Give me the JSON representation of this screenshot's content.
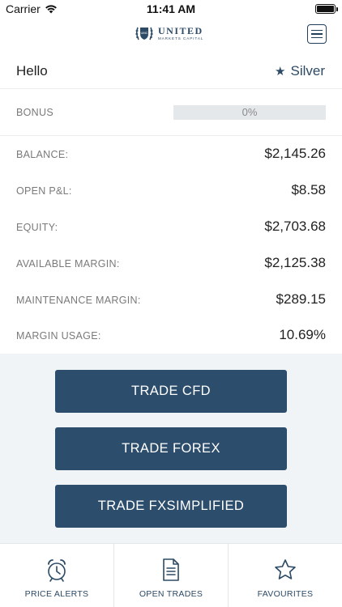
{
  "status_bar": {
    "carrier": "Carrier",
    "time": "11:41 AM"
  },
  "header": {
    "logo": {
      "main": "UNITED",
      "sub": "MARKETS CAPITAL"
    },
    "menu_icon": "hamburger-menu-icon"
  },
  "greeting": {
    "text": "Hello",
    "tier_icon": "star-icon",
    "tier": "Silver"
  },
  "bonus": {
    "label": "BONUS",
    "percent_text": "0%",
    "progress": 0
  },
  "account": [
    {
      "label": "BALANCE:",
      "value": "$2,145.26"
    },
    {
      "label": "OPEN P&L:",
      "value": "$8.58"
    },
    {
      "label": "EQUITY:",
      "value": "$2,703.68"
    },
    {
      "label": "AVAILABLE MARGIN:",
      "value": "$2,125.38"
    },
    {
      "label": "MAINTENANCE MARGIN:",
      "value": "$289.15"
    },
    {
      "label": "MARGIN USAGE:",
      "value": "10.69%"
    }
  ],
  "actions": {
    "trade_cfd": "TRADE CFD",
    "trade_forex": "TRADE FOREX",
    "trade_fxsimplified": "TRADE FXSIMPLIFIED"
  },
  "tabs": [
    {
      "label": "PRICE ALERTS",
      "icon": "alarm-clock-icon"
    },
    {
      "label": "OPEN TRADES",
      "icon": "document-icon"
    },
    {
      "label": "FAVOURITES",
      "icon": "star-outline-icon"
    }
  ],
  "colors": {
    "primary": "#2c4d6b",
    "actions_bg": "#f1f4f7",
    "label_gray": "#7a7a7a"
  }
}
